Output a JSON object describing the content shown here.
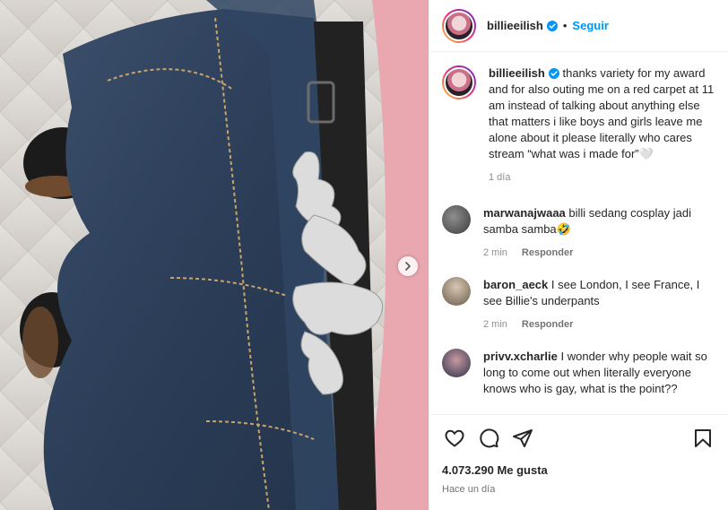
{
  "post": {
    "username": "billieeilish",
    "follow_label": "Seguir",
    "separator": "•",
    "icons": [
      "verified-badge",
      "heart-icon",
      "comment-icon",
      "share-icon",
      "bookmark-icon",
      "chevron-right-icon"
    ]
  },
  "caption": {
    "username": "billieeilish",
    "text": "thanks variety for my award and for also outing me on a red carpet at 11 am instead of talking about anything else that matters i like boys and girls leave me alone about it please literally who cares stream “what was i made for”🤍",
    "time": "1 día"
  },
  "comments": [
    {
      "username": "marwanajwaaa",
      "text": "billi sedang cosplay jadi samba samba🤣",
      "time": "2 min",
      "reply": "Responder"
    },
    {
      "username": "baron_aeck",
      "text": "I see London, I see France, I see Billie's underpants",
      "time": "2 min",
      "reply": "Responder"
    },
    {
      "username": "privv.xcharlie",
      "text": "I wonder why people wait so long to come out when literally everyone knows who is gay, what is the point??",
      "time": "",
      "reply": ""
    }
  ],
  "footer": {
    "likes": "4.073.290 Me gusta",
    "timestamp": "Hace un día"
  },
  "colors": {
    "link_blue": "#0095f6",
    "text_primary": "#262626",
    "text_secondary": "#737373",
    "verified_blue": "#0095f6"
  }
}
